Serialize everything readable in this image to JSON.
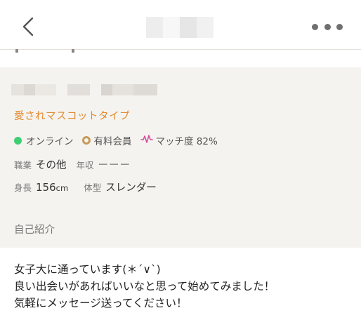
{
  "header": {
    "back_icon": "chevron-left-icon",
    "more_icon": "more-horizontal-icon",
    "title_mask_colors": [
      "#ededed",
      "#f7f7f7",
      "#e6e6e6",
      "#f1f1f1"
    ]
  },
  "profile": {
    "name_mask_colors": [
      "#e6e3df",
      "#dcd9d5",
      "#ebe8e4",
      "#f5f3ef",
      "#e2dfdb",
      "#f5f3ef",
      "#d8d4d0",
      "#e5e2de",
      "#dedad6"
    ],
    "catchphrase": "愛されマスコットタイプ",
    "catch_color": "#e08b2f",
    "online_label": "オンライン",
    "online_color": "#3ecf72",
    "paid_label": "有料会員",
    "match_label": "マッチ度 82%",
    "match_color": "#d64a9a",
    "occupation_label": "職業",
    "occupation_value": "その他",
    "income_label": "年収",
    "income_value": "ーーー",
    "height_label": "身長",
    "height_value": "156",
    "height_unit": "cm",
    "body_label": "体型",
    "body_value": "スレンダー",
    "intro_label": "自己紹介"
  },
  "intro": {
    "lines": [
      "女子大に通っています(＊´∨`)",
      "良い出会いがあればいいなと思って始めてみました！",
      "気軽にメッセージ送ってください！"
    ]
  }
}
